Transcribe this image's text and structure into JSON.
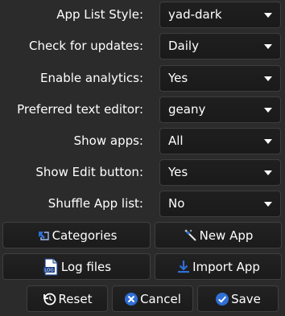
{
  "settings": [
    {
      "label": "App List Style:",
      "value": "yad-dark"
    },
    {
      "label": "Check for updates:",
      "value": "Daily"
    },
    {
      "label": "Enable analytics:",
      "value": "Yes"
    },
    {
      "label": "Preferred text editor:",
      "value": "geany"
    },
    {
      "label": "Show apps:",
      "value": "All"
    },
    {
      "label": "Show Edit button:",
      "value": "Yes"
    },
    {
      "label": "Shuffle App list:",
      "value": "No"
    }
  ],
  "buttons": {
    "categories": "Categories",
    "new_app": "New App",
    "log_files": "Log files",
    "import_app": "Import App",
    "reset": "Reset",
    "cancel": "Cancel",
    "save": "Save"
  },
  "icons": {
    "categories": "categories-icon",
    "new_app": "magic-wand-icon",
    "log_files": "log-file-icon",
    "import_app": "download-icon",
    "reset": "reset-icon",
    "cancel": "cancel-icon",
    "save": "checkmark-icon"
  },
  "colors": {
    "background": "#2b2b2b",
    "field": "#1c1c1c",
    "accent_blue": "#2f6fd6",
    "text": "#ffffff"
  }
}
